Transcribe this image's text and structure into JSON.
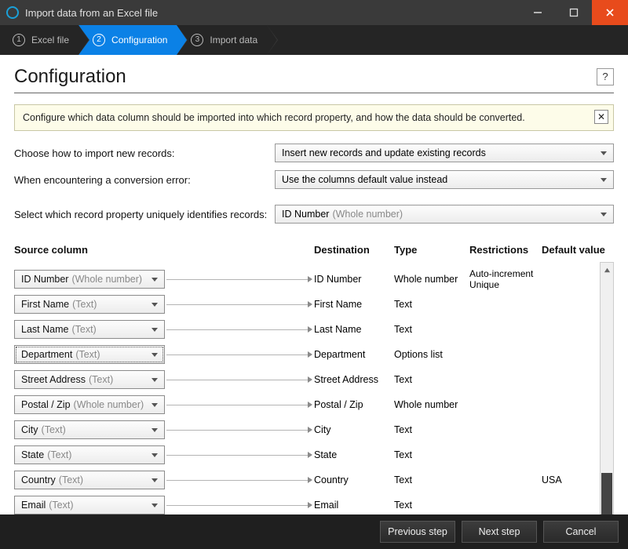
{
  "window": {
    "title": "Import data from an Excel file"
  },
  "steps": {
    "s1": {
      "num": "1",
      "label": "Excel file"
    },
    "s2": {
      "num": "2",
      "label": "Configuration"
    },
    "s3": {
      "num": "3",
      "label": "Import data"
    }
  },
  "page": {
    "title": "Configuration",
    "help": "?"
  },
  "info": {
    "text": "Configure which data column should be imported into which record property, and how the data should be converted.",
    "close": "✕"
  },
  "form": {
    "import_mode_label": "Choose how to import new records:",
    "import_mode_value": "Insert new records and update existing records",
    "conv_error_label": "When encountering a conversion error:",
    "conv_error_value": "Use the columns default value instead",
    "unique_label": "Select which record property uniquely identifies records:",
    "unique_value": "ID Number",
    "unique_type": "(Whole number)"
  },
  "table": {
    "h_source": "Source column",
    "h_dest": "Destination",
    "h_type": "Type",
    "h_restr": "Restrictions",
    "h_default": "Default value"
  },
  "rows": [
    {
      "src": "ID Number",
      "srcType": "(Whole number)",
      "dest": "ID Number",
      "type": "Whole number",
      "restr": "Auto-increment\nUnique",
      "def": ""
    },
    {
      "src": "First Name",
      "srcType": "(Text)",
      "dest": "First Name",
      "type": "Text",
      "restr": "",
      "def": ""
    },
    {
      "src": "Last Name",
      "srcType": "(Text)",
      "dest": "Last Name",
      "type": "Text",
      "restr": "",
      "def": ""
    },
    {
      "src": "Department",
      "srcType": "(Text)",
      "dest": "Department",
      "type": "Options list",
      "restr": "",
      "def": "",
      "dotted": true
    },
    {
      "src": "Street Address",
      "srcType": "(Text)",
      "dest": "Street Address",
      "type": "Text",
      "restr": "",
      "def": ""
    },
    {
      "src": "Postal / Zip",
      "srcType": "(Whole number)",
      "dest": "Postal / Zip",
      "type": "Whole number",
      "restr": "",
      "def": ""
    },
    {
      "src": "City",
      "srcType": "(Text)",
      "dest": "City",
      "type": "Text",
      "restr": "",
      "def": ""
    },
    {
      "src": "State",
      "srcType": "(Text)",
      "dest": "State",
      "type": "Text",
      "restr": "",
      "def": ""
    },
    {
      "src": "Country",
      "srcType": "(Text)",
      "dest": "Country",
      "type": "Text",
      "restr": "",
      "def": "USA"
    },
    {
      "src": "Email",
      "srcType": "(Text)",
      "dest": "Email",
      "type": "Text",
      "restr": "",
      "def": ""
    }
  ],
  "footer": {
    "prev": "Previous step",
    "next": "Next step",
    "cancel": "Cancel"
  }
}
